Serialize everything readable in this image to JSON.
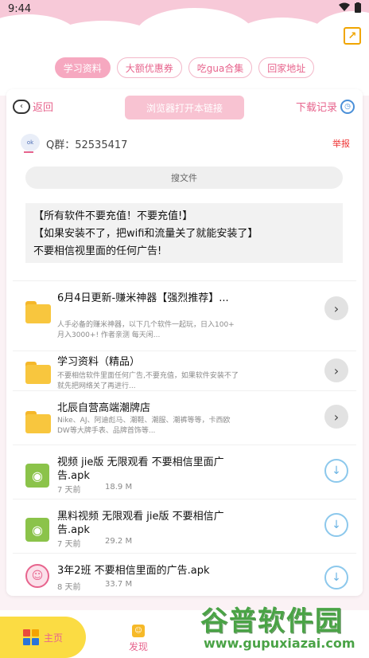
{
  "status_bar": {
    "time": "9:44"
  },
  "top_tabs": [
    {
      "label": "学习资料",
      "active": true
    },
    {
      "label": "大额优惠券",
      "active": false
    },
    {
      "label": "吃gua合集",
      "active": false
    },
    {
      "label": "回家地址",
      "active": false
    }
  ],
  "nav": {
    "back_label": "返回",
    "open_in_browser_label": "浏览器打开本链接",
    "downloads_label": "下载记录"
  },
  "group": {
    "qq_label": "Q群：52535417",
    "report_label": "举报"
  },
  "search": {
    "placeholder": "搜文件"
  },
  "notice": [
    "【所有软件不要充值！不要充值!】",
    "【如果安装不了，把wifi和流量关了就能安装了】",
    "不要相信视里面的任何广告!"
  ],
  "files": [
    {
      "type": "folder",
      "title": "6月4日更新-赚米神器【强烈推荐】...",
      "desc": "人手必备的赚米神器，以下几个软件一起玩，日入100+ 月入3000+! 作者亲测 每天闲...",
      "icon": "folder-icon"
    },
    {
      "type": "folder",
      "title": "学习资料（精品）",
      "desc": "不要相信软件里面任何广告,不要充值，如果软件安装不了就先把网络关了再进行...",
      "icon": "folder-icon"
    },
    {
      "type": "folder",
      "title": "北辰自营高端潮牌店",
      "desc": "Nike、AJ、阿迪彪马、潮鞋、潮服、潮裤等等，卡西欧DW等大牌手表、品牌首饰等...",
      "icon": "folder-icon"
    },
    {
      "type": "apk",
      "title": "视频 jie版 无限观看 不要相信里面广告.apk",
      "date": "7 天前",
      "size": "18.9 M",
      "icon": "android-icon"
    },
    {
      "type": "apk",
      "title": "黑料视频 无限观看 jie版 不要相信广告.apk",
      "date": "7 天前",
      "size": "29.2 M",
      "icon": "android-icon"
    },
    {
      "type": "apk",
      "title": "3年2班 不要相信里面的广告.apk",
      "date": "8 天前",
      "size": "33.7 M",
      "icon": "app-logo-icon"
    }
  ],
  "bottom_nav": {
    "home_label": "主页",
    "discover_label": "发现"
  },
  "watermark": {
    "title": "谷普软件园",
    "url": "www.gupuxiazai.com"
  },
  "colors": {
    "accent_pink": "#e7648d",
    "header_pink": "#f7c9d8",
    "folder_yellow": "#f8c63e",
    "android_green": "#8bc34a",
    "home_tab_yellow": "#fbdc43",
    "watermark_green": "#4aa346"
  }
}
